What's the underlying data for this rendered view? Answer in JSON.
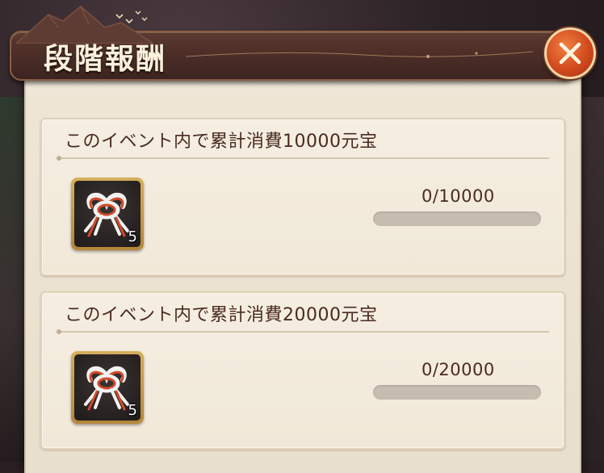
{
  "dialog": {
    "title": "段階報酬"
  },
  "milestones": [
    {
      "title": "このイベント内で累計消費10000元宝",
      "reward_count": "5",
      "progress_text": "0/10000",
      "progress": 0
    },
    {
      "title": "このイベント内で累計消費20000元宝",
      "reward_count": "5",
      "progress_text": "0/20000",
      "progress": 0
    }
  ],
  "icons": {
    "close": "close-x-icon",
    "reward": "red-white-knot-cord-icon"
  },
  "colors": {
    "accent_close": "#d24a1e",
    "title_bar": "#4a2c26",
    "panel_bg": "#efe6d6",
    "card_text": "#4a2a22",
    "item_frame": "#c99a4a"
  }
}
